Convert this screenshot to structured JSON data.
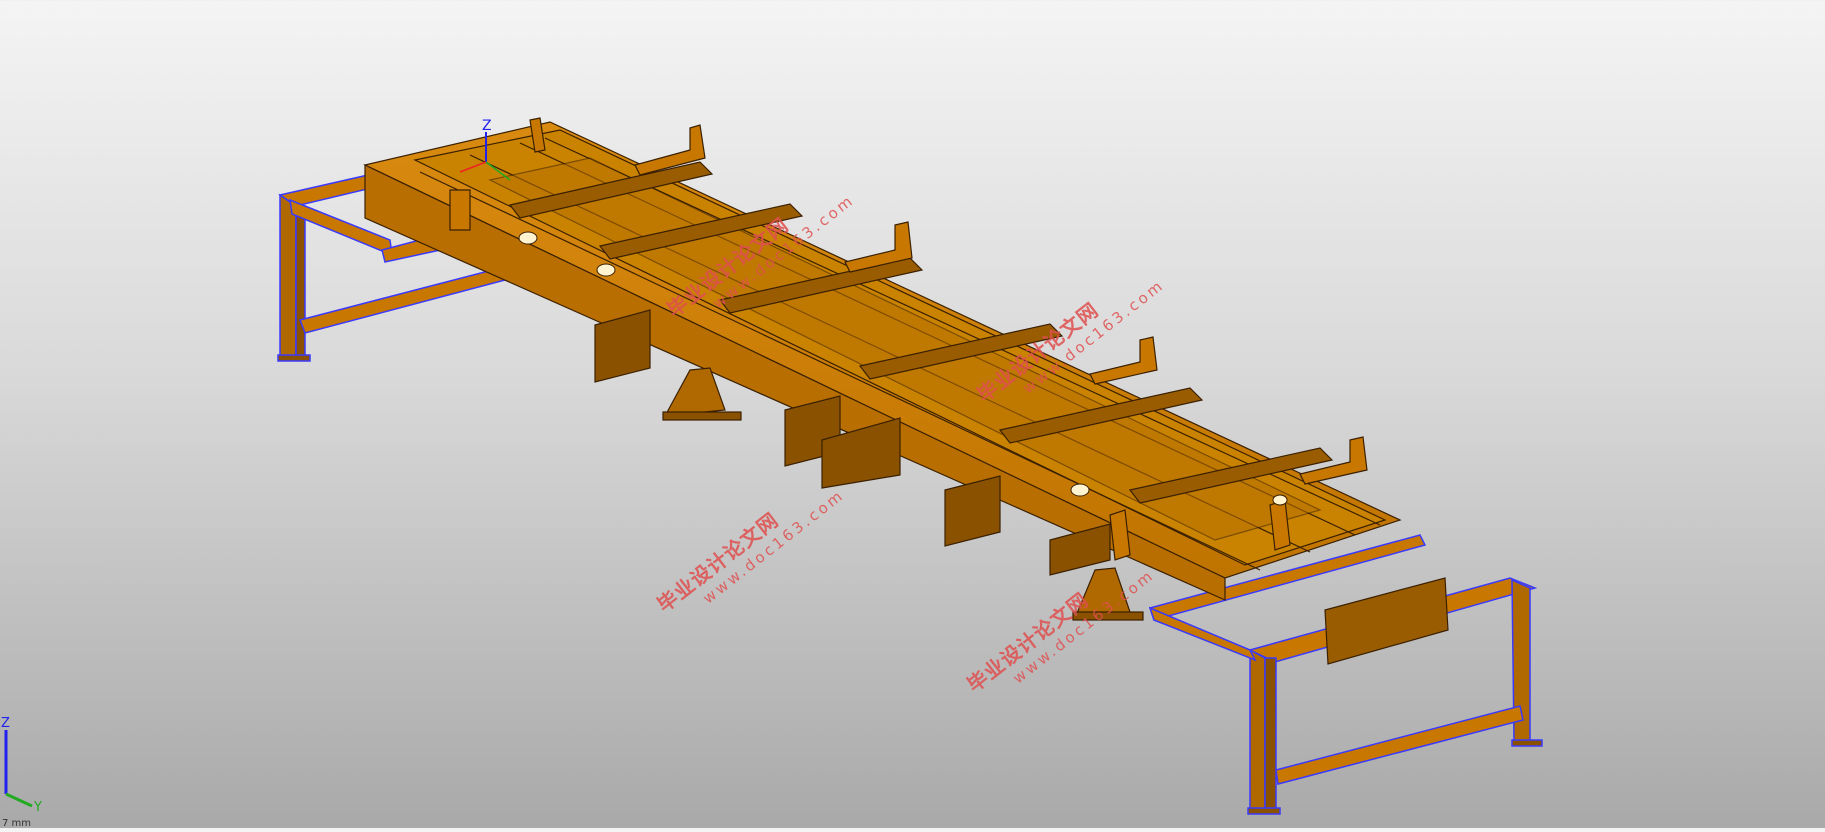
{
  "viewport": {
    "background_top": "#f4f4f4",
    "background_bottom": "#a9a9a9",
    "model_color": "#c87800",
    "edge_color": "#3a2000",
    "highlight_edge_color": "#3a3aff"
  },
  "model_triad": {
    "z_label": "Z"
  },
  "corner_triad": {
    "z_label": "Z",
    "y_label": "Y",
    "unit_text": "7 mm"
  },
  "watermarks": [
    {
      "line1": "毕业设计论文网",
      "line2": "www.doc163.com"
    },
    {
      "line1": "毕业设计论文网",
      "line2": "www.doc163.com"
    },
    {
      "line1": "毕业设计论文网",
      "line2": "www.doc163.com"
    },
    {
      "line1": "毕业设计论文网",
      "line2": "www.doc163.com"
    }
  ]
}
